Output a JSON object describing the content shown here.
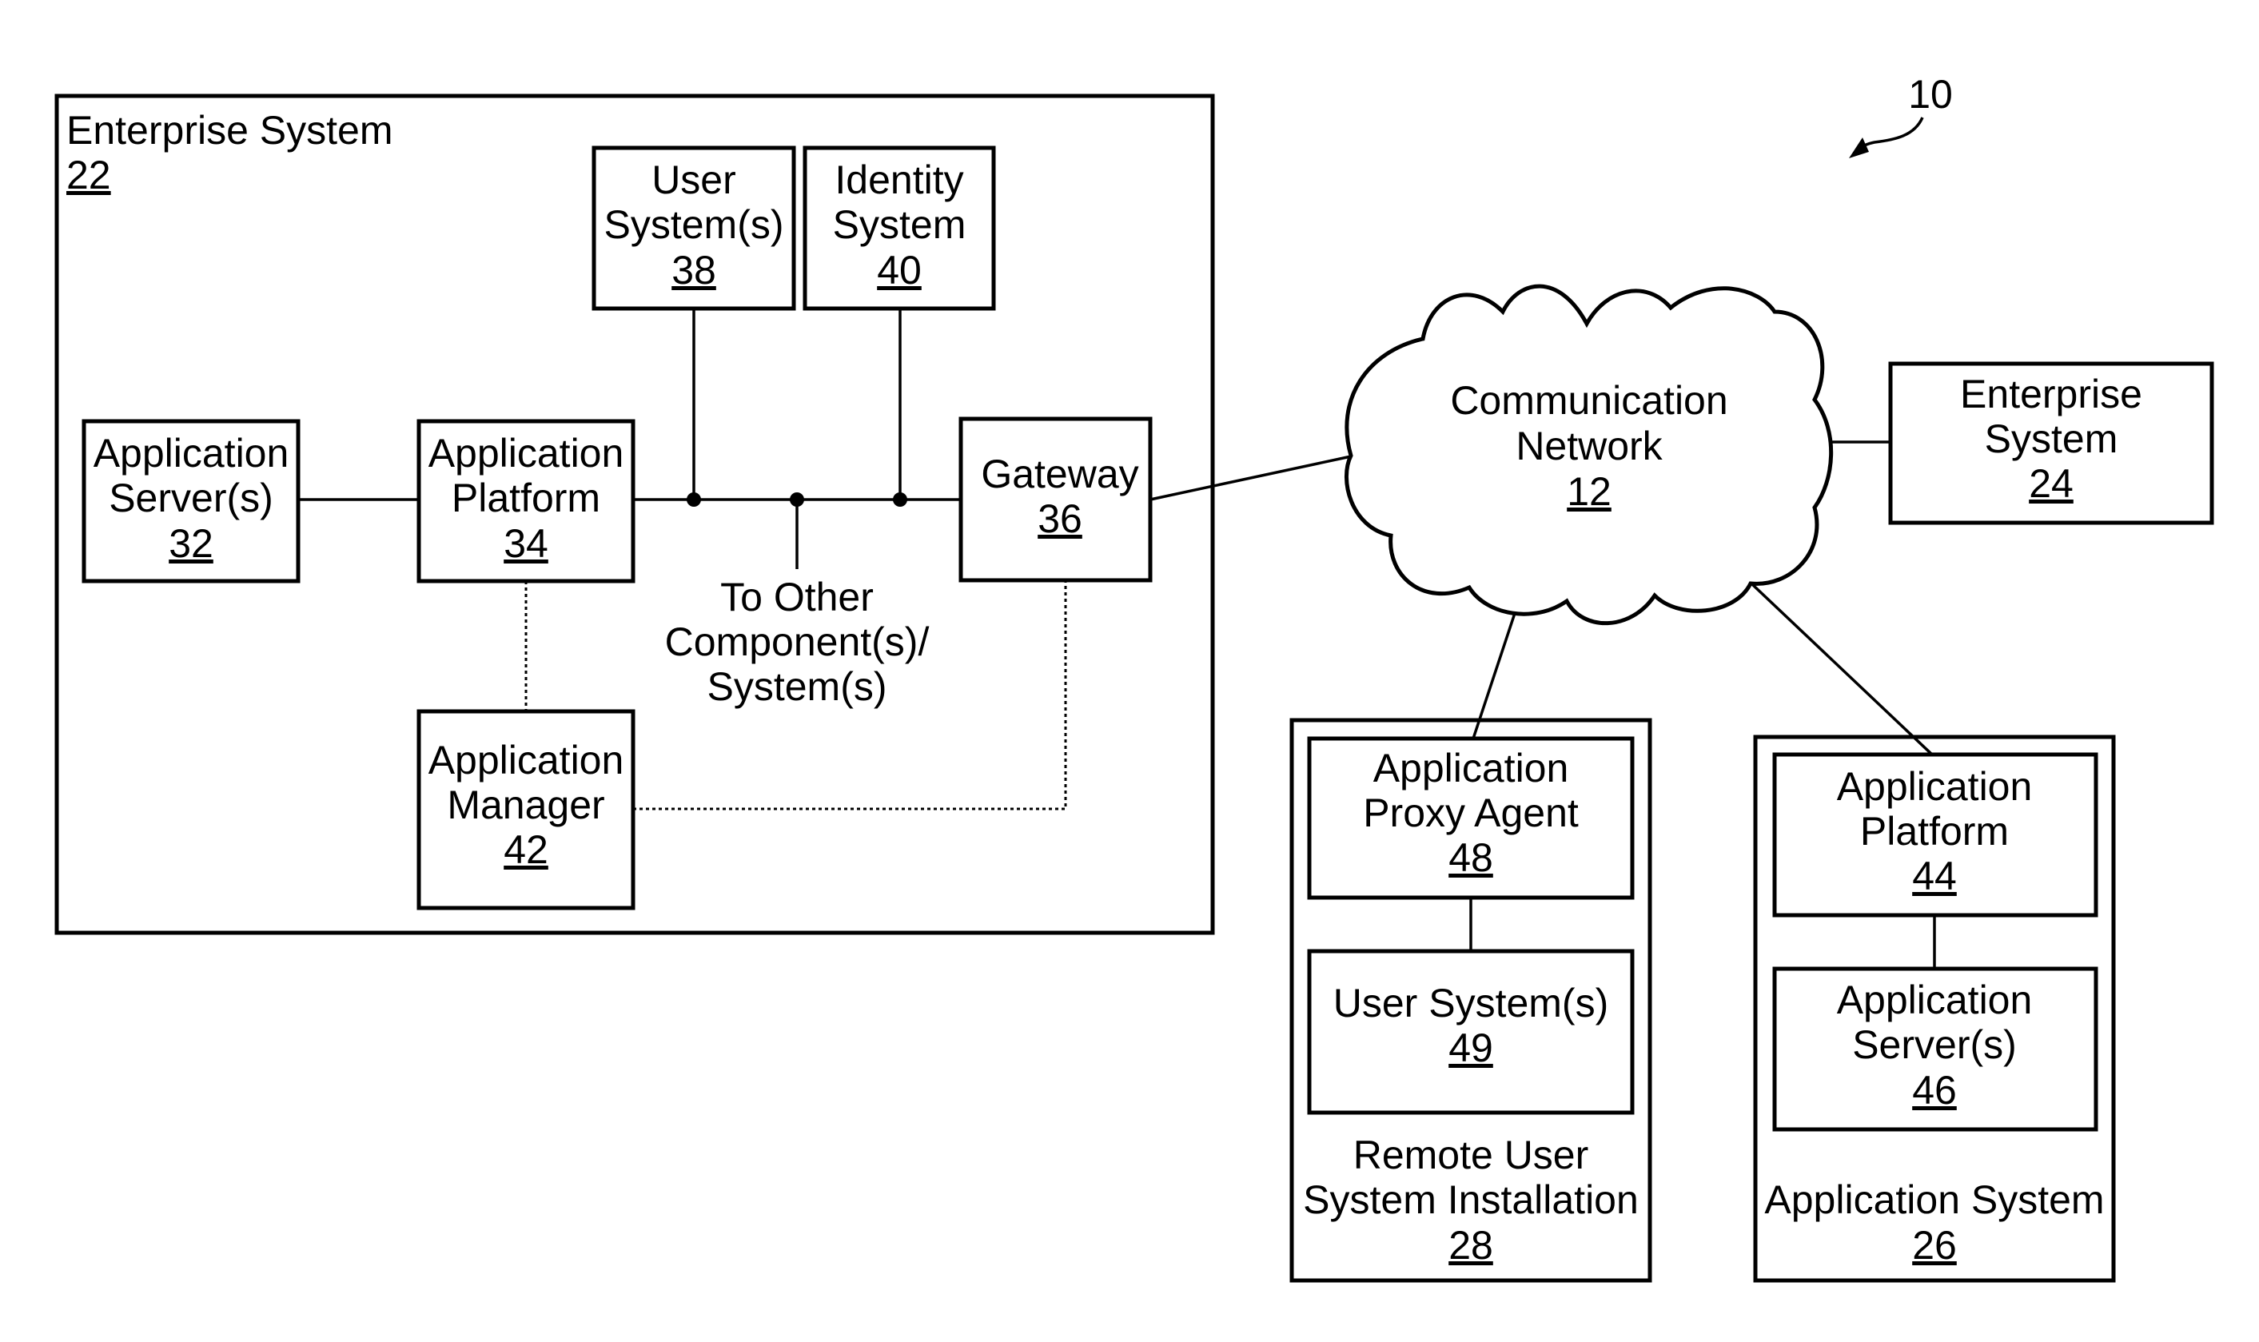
{
  "figure_ref": "10",
  "enterprise_system_22": {
    "title": "Enterprise System",
    "num": "22"
  },
  "user_systems_38": {
    "lines": [
      "User",
      "System(s)"
    ],
    "num": "38"
  },
  "identity_system_40": {
    "lines": [
      "Identity",
      "System"
    ],
    "num": "40"
  },
  "app_servers_32": {
    "lines": [
      "Application",
      "Server(s)"
    ],
    "num": "32"
  },
  "app_platform_34": {
    "lines": [
      "Application",
      "Platform"
    ],
    "num": "34"
  },
  "gateway_36": {
    "lines": [
      "Gateway"
    ],
    "num": "36"
  },
  "to_other": {
    "lines": [
      "To Other",
      "Component(s)/",
      "System(s)"
    ]
  },
  "app_manager_42": {
    "lines": [
      "Application",
      "Manager"
    ],
    "num": "42"
  },
  "network_12": {
    "lines": [
      "Communication",
      "Network"
    ],
    "num": "12"
  },
  "enterprise_system_24": {
    "lines": [
      "Enterprise",
      "System"
    ],
    "num": "24"
  },
  "remote_install_28": {
    "lines": [
      "Remote User",
      "System Installation"
    ],
    "num": "28"
  },
  "proxy_agent_48": {
    "lines": [
      "Application",
      "Proxy Agent"
    ],
    "num": "48"
  },
  "user_systems_49": {
    "lines": [
      "User System(s)"
    ],
    "num": "49"
  },
  "app_system_26": {
    "lines": [
      "Application System"
    ],
    "num": "26"
  },
  "app_platform_44": {
    "lines": [
      "Application",
      "Platform"
    ],
    "num": "44"
  },
  "app_servers_46": {
    "lines": [
      "Application",
      "Server(s)"
    ],
    "num": "46"
  }
}
